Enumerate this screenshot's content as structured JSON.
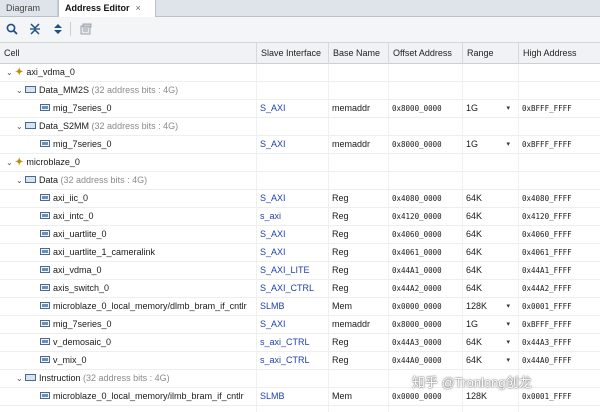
{
  "tabs": [
    {
      "label": "Diagram",
      "active": false
    },
    {
      "label": "Address Editor",
      "active": true,
      "close": "×"
    }
  ],
  "toolbar": {
    "icons": [
      "search-icon",
      "collapse-all-icon",
      "expand-all-icon",
      "auto-assign-icon"
    ]
  },
  "columns": {
    "cell": "Cell",
    "slave_interface": "Slave Interface",
    "base_name": "Base Name",
    "offset_address": "Offset Address",
    "range": "Range",
    "high_address": "High Address"
  },
  "rows": [
    {
      "kind": "master",
      "name": "axi_vdma_0",
      "toggle": "⌄"
    },
    {
      "kind": "space",
      "name": "Data_MM2S",
      "hint": "(32 address bits : 4G)",
      "toggle": "⌄"
    },
    {
      "kind": "seg",
      "name": "mig_7series_0",
      "slave": "S_AXI",
      "base": "memaddr",
      "offset": "0x8000_0000",
      "range": "1G",
      "high": "0xBFFF_FFFF"
    },
    {
      "kind": "space",
      "name": "Data_S2MM",
      "hint": "(32 address bits : 4G)",
      "toggle": "⌄"
    },
    {
      "kind": "seg",
      "name": "mig_7series_0",
      "slave": "S_AXI",
      "base": "memaddr",
      "offset": "0x8000_0000",
      "range": "1G",
      "high": "0xBFFF_FFFF"
    },
    {
      "kind": "master",
      "name": "microblaze_0",
      "toggle": "⌄"
    },
    {
      "kind": "space",
      "name": "Data",
      "hint": "(32 address bits : 4G)",
      "toggle": "⌄"
    },
    {
      "kind": "seg",
      "name": "axi_iic_0",
      "slave": "S_AXI",
      "base": "Reg",
      "offset": "0x4080_0000",
      "range": "64K",
      "high": "0x4080_FFFF"
    },
    {
      "kind": "seg",
      "name": "axi_intc_0",
      "slave": "s_axi",
      "base": "Reg",
      "offset": "0x4120_0000",
      "range": "64K",
      "high": "0x4120_FFFF"
    },
    {
      "kind": "seg",
      "name": "axi_uartlite_0",
      "slave": "S_AXI",
      "base": "Reg",
      "offset": "0x4060_0000",
      "range": "64K",
      "high": "0x4060_FFFF"
    },
    {
      "kind": "seg",
      "name": "axi_uartlite_1_cameralink",
      "slave": "S_AXI",
      "base": "Reg",
      "offset": "0x4061_0000",
      "range": "64K",
      "high": "0x4061_FFFF"
    },
    {
      "kind": "seg",
      "name": "axi_vdma_0",
      "slave": "S_AXI_LITE",
      "base": "Reg",
      "offset": "0x44A1_0000",
      "range": "64K",
      "high": "0x44A1_FFFF"
    },
    {
      "kind": "seg",
      "name": "axis_switch_0",
      "slave": "S_AXI_CTRL",
      "base": "Reg",
      "offset": "0x44A2_0000",
      "range": "64K",
      "high": "0x44A2_FFFF"
    },
    {
      "kind": "seg",
      "name": "microblaze_0_local_memory/dlmb_bram_if_cntlr",
      "slave": "SLMB",
      "base": "Mem",
      "offset": "0x0000_0000",
      "range": "128K",
      "high": "0x0001_FFFF"
    },
    {
      "kind": "seg",
      "name": "mig_7series_0",
      "slave": "S_AXI",
      "base": "memaddr",
      "offset": "0x8000_0000",
      "range": "1G",
      "high": "0xBFFF_FFFF"
    },
    {
      "kind": "seg",
      "name": "v_demosaic_0",
      "slave": "s_axi_CTRL",
      "base": "Reg",
      "offset": "0x44A3_0000",
      "range": "64K",
      "high": "0x44A3_FFFF"
    },
    {
      "kind": "seg",
      "name": "v_mix_0",
      "slave": "s_axi_CTRL",
      "base": "Reg",
      "offset": "0x44A0_0000",
      "range": "64K",
      "high": "0x44A0_FFFF"
    },
    {
      "kind": "space",
      "name": "Instruction",
      "hint": "(32 address bits : 4G)",
      "toggle": "⌄"
    },
    {
      "kind": "seg",
      "name": "microblaze_0_local_memory/ilmb_bram_if_cntlr",
      "slave": "SLMB",
      "base": "Mem",
      "offset": "0x0000_0000",
      "range": "128K",
      "high": "0x0001_FFFF"
    }
  ],
  "dropdown_glyph": "▾",
  "watermark": "知乎 @Tronlong创龙"
}
